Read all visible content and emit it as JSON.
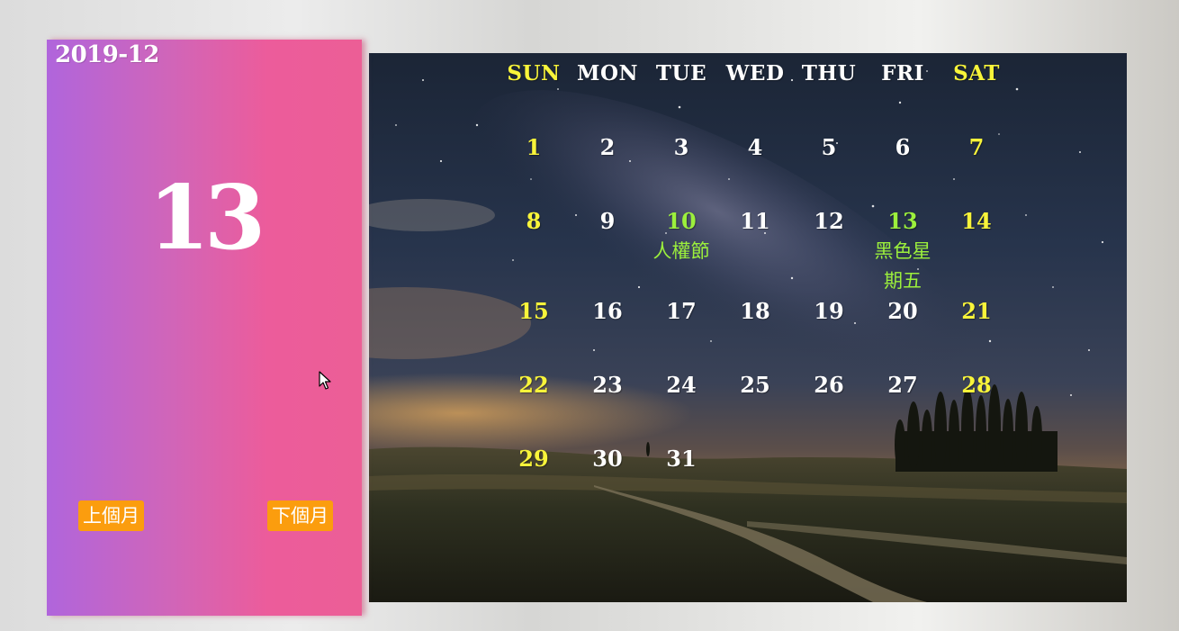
{
  "side_panel": {
    "year_month": "2019-12",
    "selected_day": "13",
    "prev_label": "上個月",
    "next_label": "下個月"
  },
  "calendar": {
    "weekdays": [
      "SUN",
      "MON",
      "TUE",
      "WED",
      "THU",
      "FRI",
      "SAT"
    ],
    "weeks": [
      [
        "1",
        "2",
        "3",
        "4",
        "5",
        "6",
        "7"
      ],
      [
        "8",
        "9",
        "10",
        "11",
        "12",
        "13",
        "14"
      ],
      [
        "15",
        "16",
        "17",
        "18",
        "19",
        "20",
        "21"
      ],
      [
        "22",
        "23",
        "24",
        "25",
        "26",
        "27",
        "28"
      ],
      [
        "29",
        "30",
        "31",
        "",
        "",
        "",
        ""
      ]
    ],
    "holidays": [
      {
        "day": "10",
        "name": "人權節"
      },
      {
        "day": "13",
        "name_lines": [
          "黑色星",
          "期五"
        ]
      }
    ]
  },
  "colors": {
    "weekend": "#f8f43a",
    "holiday": "#9cf03c",
    "button_bg": "#fb9d0e",
    "panel_gradient_start": "#b065dc",
    "panel_gradient_end": "#ec5e96"
  },
  "icons": {
    "cursor": "mouse-pointer-icon"
  }
}
